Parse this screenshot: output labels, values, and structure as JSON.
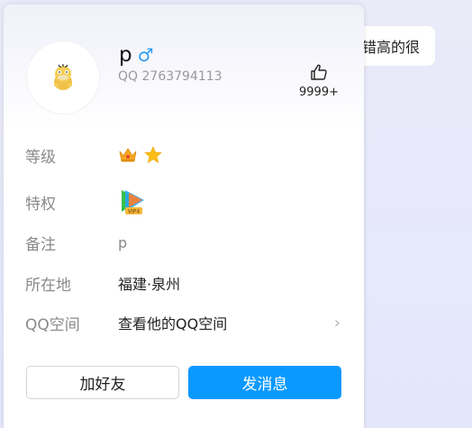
{
  "background_chat": {
    "bubble_text": "错高的很"
  },
  "profile": {
    "nickname": "p",
    "gender_icon": "male-icon",
    "qq_label": "QQ",
    "qq_number": "2763794113",
    "likes": "9999+"
  },
  "details": {
    "level_label": "等级",
    "level_icons": [
      "crown-icon",
      "star-icon"
    ],
    "privilege_label": "特权",
    "privilege_badge": "VIP4",
    "remark_label": "备注",
    "remark_value": "p",
    "location_label": "所在地",
    "location_value": "福建·泉州",
    "qzone_label": "QQ空间",
    "qzone_value": "查看他的QQ空间"
  },
  "actions": {
    "add_friend_label": "加好友",
    "send_message_label": "发消息"
  },
  "colors": {
    "accent": "#0b99ff",
    "male": "#2c9cf6",
    "label_gray": "#8a8a8a"
  }
}
